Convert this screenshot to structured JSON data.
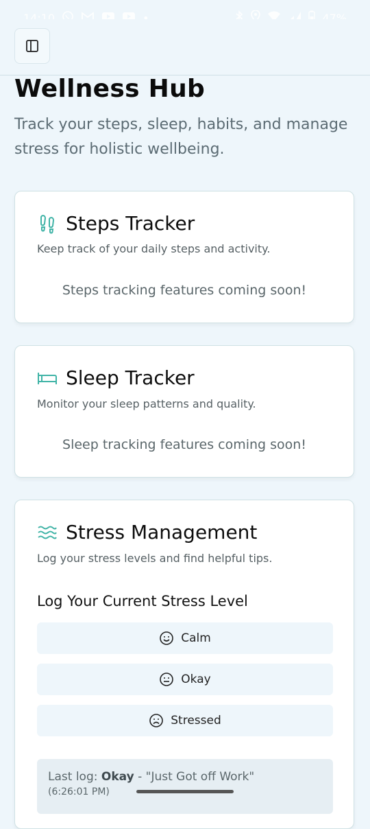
{
  "status_bar": {
    "time": "14:10",
    "battery": "47%",
    "dot": "•"
  },
  "app": {
    "title": "Wellness Hub",
    "subtitle": "Track your steps, sleep, habits, and manage stress for holistic wellbeing."
  },
  "steps_card": {
    "icon": "footprints-icon",
    "title": "Steps Tracker",
    "description": "Keep track of your daily steps and activity.",
    "coming_soon": "Steps tracking features coming soon!"
  },
  "sleep_card": {
    "icon": "bed-icon",
    "title": "Sleep Tracker",
    "description": "Monitor your sleep patterns and quality.",
    "coming_soon": "Sleep tracking features coming soon!"
  },
  "stress_card": {
    "icon": "waves-icon",
    "title": "Stress Management",
    "description": "Log your stress levels and find helpful tips.",
    "log_heading": "Log Your Current Stress Level",
    "options": [
      {
        "label": "Calm",
        "icon": "smile-icon"
      },
      {
        "label": "Okay",
        "icon": "neutral-face-icon"
      },
      {
        "label": "Stressed",
        "icon": "frown-icon"
      }
    ],
    "last_log": {
      "prefix": "Last log:",
      "level": "Okay",
      "separator": "-",
      "note": "\"Just Got off Work\"",
      "time": "(6:26:01 PM)"
    }
  },
  "colors": {
    "accent": "#3fb3a6",
    "background": "#eef6fb",
    "card": "#ffffff"
  }
}
